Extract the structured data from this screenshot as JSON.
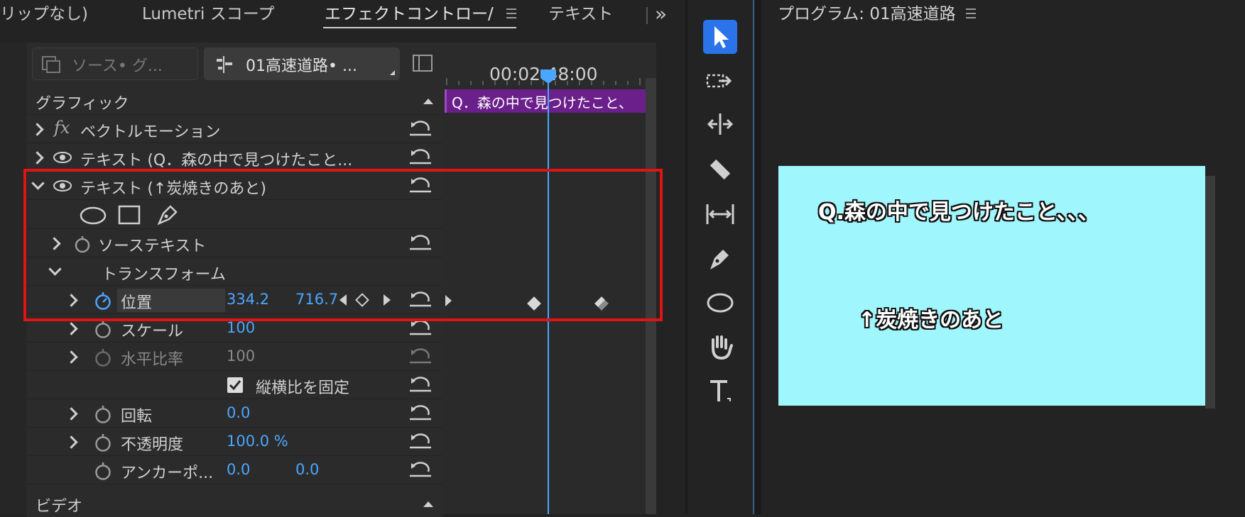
{
  "tabs": [
    {
      "label": "リップなし)",
      "active": false
    },
    {
      "label": "Lumetri スコープ",
      "active": false
    },
    {
      "label": "エフェクトコントロー/",
      "active": true
    },
    {
      "label": "テキスト",
      "active": false
    }
  ],
  "overflow_label": "»",
  "source_selector": {
    "label": "ソース• グ..."
  },
  "sequence_selector": {
    "label": "01高速道路• ..."
  },
  "timecode": "00:02:48:00",
  "clip_label": "Q．森の中で見つけたこと、",
  "sections": {
    "graphic": "グラフィック",
    "video": "ビデオ"
  },
  "effects": [
    {
      "label": "ベクトルモーション",
      "icon": "fx-icon"
    },
    {
      "label": "テキスト (Q．森の中で見つけたこと...",
      "icon": "eye-icon"
    },
    {
      "label": "テキスト (↑炭焼きのあと)",
      "icon": "eye-icon"
    }
  ],
  "properties": {
    "source_text": "ソーステキスト",
    "transform": "トランスフォーム",
    "position": {
      "label": "位置",
      "x": "334.2",
      "y": "716.7"
    },
    "scale": {
      "label": "スケール",
      "value": "100"
    },
    "scale_width": {
      "label": "水平比率",
      "value": "100"
    },
    "uniform_scale": {
      "label": "縦横比を固定",
      "checked": true
    },
    "rotation": {
      "label": "回転",
      "value": "0.0"
    },
    "opacity": {
      "label": "不透明度",
      "value": "100.0 %"
    },
    "anchor": {
      "label": "アンカーポ...",
      "x": "0.0",
      "y": "0.0"
    }
  },
  "program": {
    "title": "プログラム: 01高速道路",
    "caption1": "Q.森の中で見つけたこと、、、",
    "caption2": "↑炭焼きのあと",
    "bg_color": "#9ff6fd"
  },
  "colors": {
    "accent": "#4ba6ff",
    "highlight": "#e11414",
    "clip": "#6a1f8a"
  },
  "tools": [
    "selection-tool-icon",
    "track-select-forward-icon",
    "ripple-edit-icon",
    "razor-icon",
    "slip-icon",
    "pen-icon",
    "ellipse-icon",
    "hand-icon",
    "type-icon"
  ]
}
